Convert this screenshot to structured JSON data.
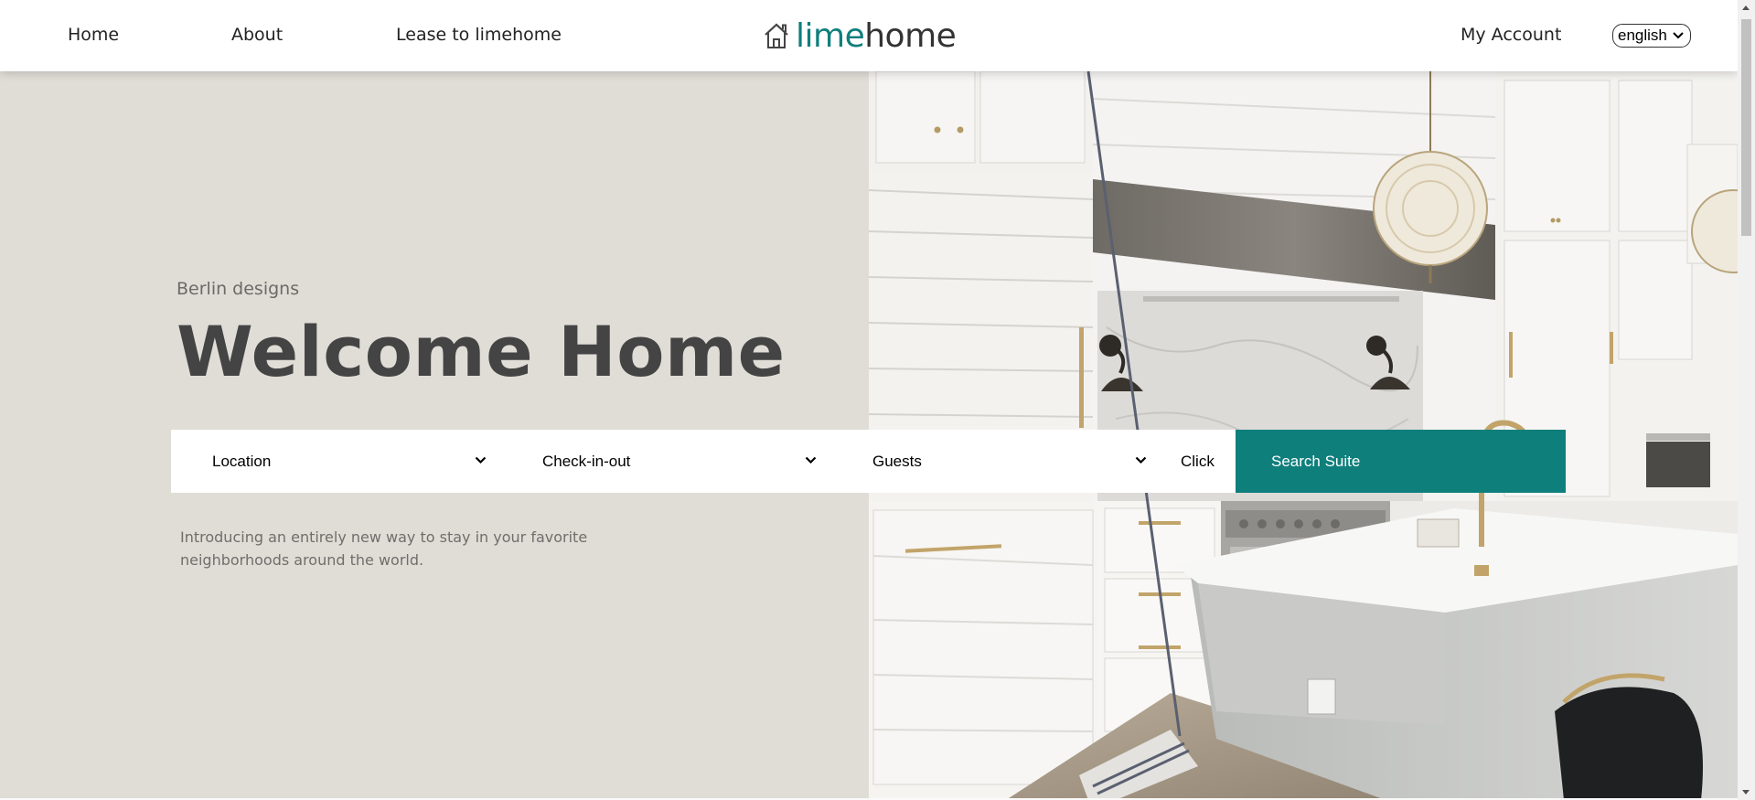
{
  "nav": {
    "home": "Home",
    "about": "About",
    "lease": "Lease to limehome",
    "account": "My Account",
    "language": "english"
  },
  "logo": {
    "part1": "lime",
    "part2": "home"
  },
  "hero": {
    "subtitle": "Berlin designs",
    "title": "Welcome Home",
    "intro": "Introducing an entirely new way to stay in your favorite neighborhoods around the world."
  },
  "search": {
    "location": "Location",
    "checkin": "Check-in-out",
    "guests": "Guests",
    "click": "Click",
    "button": "Search Suite"
  },
  "colors": {
    "brand": "#0f7f7c",
    "hero_bg": "#e0ddd7",
    "text": "#444444"
  }
}
